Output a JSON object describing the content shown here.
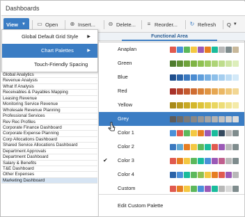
{
  "window": {
    "title": "Dashboards"
  },
  "toolbar": {
    "view_label": "View",
    "open_label": "Open",
    "insert_label": "Insert...",
    "delete_label": "Delete...",
    "reorder_label": "Reorder...",
    "refresh_label": "Refresh",
    "search_label": "Q"
  },
  "view_menu": {
    "items": [
      {
        "label": "Global Default Grid Style"
      },
      {
        "label": "Chart Palettes"
      },
      {
        "label": "Touch-Friendly Spacing"
      }
    ]
  },
  "grid": {
    "header_label": "Functional Area"
  },
  "dashboards": {
    "items": [
      "Global Analytics",
      "Revenue Analysis",
      "What If Analysis",
      "Receivables & Payables Mapping",
      "Leasing Revenue",
      "Monitoring Service Revenue",
      "Wholesale Revenue Planning",
      "Professional Services",
      "Rev Rec Profiles",
      "Corporate Finance Dashboard",
      "Corporate Expense Planning",
      "Corp Allocations Dashboard",
      "Shared Service Allocations Dashboard",
      "Department Approvals",
      "Department Dashboard",
      "Salary & Benefits",
      "T&E Dashboard",
      "Other Expenses",
      "Marketing Dashboard"
    ]
  },
  "palettes": {
    "items": [
      {
        "label": "Anaplan",
        "checked": false,
        "selected": false,
        "colors": [
          "#e05a4f",
          "#4a90d9",
          "#5cb85c",
          "#f4c842",
          "#9b59b6",
          "#e67e22",
          "#1abc9c",
          "#b8b8b8",
          "#7f8c8d",
          "#c8b89a"
        ]
      },
      {
        "label": "Green",
        "checked": false,
        "selected": false,
        "colors": [
          "#4e7b2e",
          "#5f8f35",
          "#6fa33c",
          "#7fb445",
          "#8fc152",
          "#9ecb63",
          "#aed478",
          "#bedd8c",
          "#cde5a3",
          "#ddeebb"
        ]
      },
      {
        "label": "Blue",
        "checked": false,
        "selected": false,
        "colors": [
          "#1f4e8c",
          "#2a63a8",
          "#3a78bf",
          "#4b8cd1",
          "#5f9edb",
          "#76afe3",
          "#8dbfe9",
          "#a5ceef",
          "#bcdcf4",
          "#d3e9f8"
        ]
      },
      {
        "label": "Red",
        "checked": false,
        "selected": false,
        "colors": [
          "#a8322a",
          "#b8472c",
          "#c45a2e",
          "#cf6d32",
          "#d88238",
          "#e09542",
          "#e6a752",
          "#ebb865",
          "#efc87b",
          "#f2d794"
        ]
      },
      {
        "label": "Yellow",
        "checked": false,
        "selected": false,
        "colors": [
          "#a88b1a",
          "#b99a1f",
          "#c8a924",
          "#d4b72c",
          "#ddc33a",
          "#e4cd4c",
          "#e9d661",
          "#eddd78",
          "#f1e490",
          "#f4eaa8"
        ]
      },
      {
        "label": "Grey",
        "checked": false,
        "selected": true,
        "colors": [
          "#5c5c5c",
          "#6b6b6b",
          "#7a7a7a",
          "#888888",
          "#979797",
          "#a5a5a5",
          "#b3b3b3",
          "#c1c1c1",
          "#cfcfcf",
          "#dcdcdc"
        ]
      },
      {
        "label": "Color 1",
        "checked": false,
        "selected": false,
        "colors": [
          "#4a90d9",
          "#e05a4f",
          "#5cb85c",
          "#f4c842",
          "#e67e22",
          "#9b59b6",
          "#1abc9c",
          "#34495e",
          "#b8b8b8",
          "#7f8c8d"
        ]
      },
      {
        "label": "Color 2",
        "checked": false,
        "selected": false,
        "colors": [
          "#3a78bf",
          "#5fa8d3",
          "#e67e22",
          "#f4c842",
          "#5cb85c",
          "#1abc9c",
          "#e05a4f",
          "#9b59b6",
          "#b8b8b8",
          "#7f8c8d"
        ]
      },
      {
        "label": "Color 3",
        "checked": true,
        "selected": false,
        "colors": [
          "#e05a4f",
          "#e67e22",
          "#f4c842",
          "#5cb85c",
          "#1abc9c",
          "#4a90d9",
          "#9b59b6",
          "#c05f8e",
          "#b8b8b8",
          "#7f8c8d"
        ]
      },
      {
        "label": "Color 4",
        "checked": false,
        "selected": false,
        "colors": [
          "#2a63a8",
          "#4a90d9",
          "#1abc9c",
          "#5cb85c",
          "#8fc152",
          "#f4c842",
          "#e67e22",
          "#e05a4f",
          "#9b59b6",
          "#b8b8b8"
        ]
      },
      {
        "label": "Custom",
        "checked": false,
        "selected": false,
        "colors": [
          "#e05a4f",
          "#e67e22",
          "#f4c842",
          "#5cb85c",
          "#4a90d9",
          "#9b59b6",
          "#1abc9c",
          "#b8b8b8",
          "#d9d9d9",
          "#7f8c8d"
        ]
      }
    ],
    "edit_label": "Edit Custom Palette",
    "check_glyph": "✔"
  }
}
